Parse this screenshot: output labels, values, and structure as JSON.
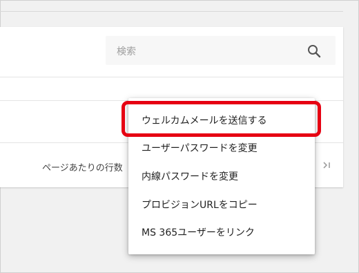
{
  "search": {
    "placeholder": "検索",
    "icon": "search-icon"
  },
  "pagination": {
    "rows_per_page_label": "ページあたりの行数",
    "last_page_icon": "last-page-icon"
  },
  "menu": {
    "items": [
      {
        "label": "ウェルカムメールを送信する"
      },
      {
        "label": "ユーザーパスワードを変更"
      },
      {
        "label": "内線パスワードを変更"
      },
      {
        "label": "プロビジョンURLをコピー"
      },
      {
        "label": "MS 365ユーザーをリンク"
      }
    ]
  },
  "highlight": {
    "color": "#e60012"
  }
}
